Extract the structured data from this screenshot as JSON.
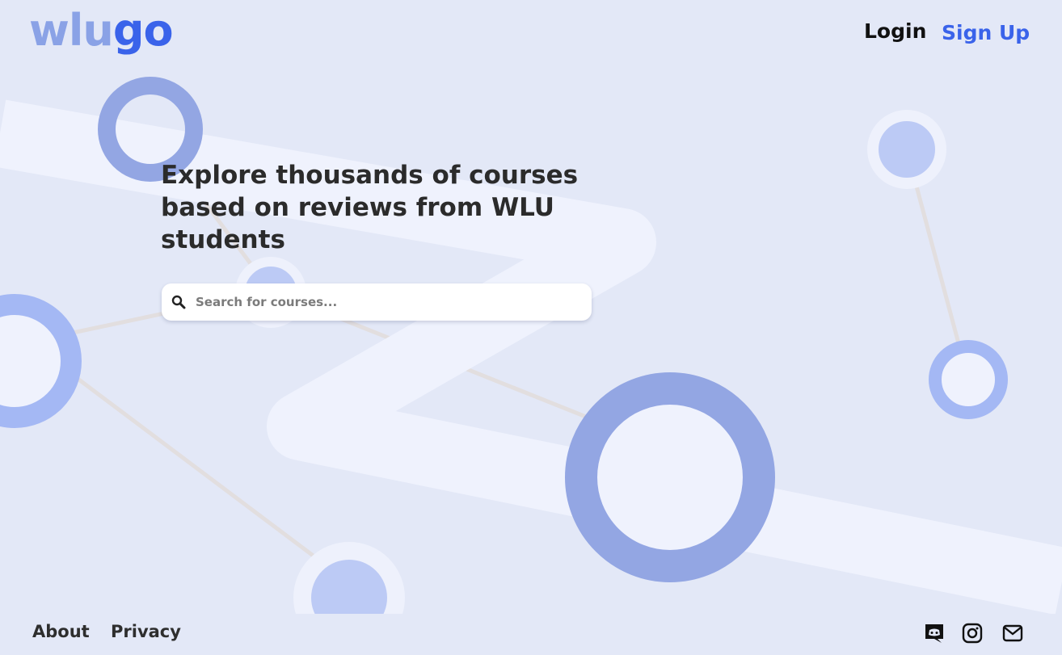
{
  "brand": {
    "logo_part1": "wlu",
    "logo_part2": "go",
    "color_light": "#8aa2e6",
    "color_dark": "#3a63ea"
  },
  "nav": {
    "login_label": "Login",
    "signup_label": "Sign Up"
  },
  "hero": {
    "headline": "Explore thousands of courses based on reviews from WLU students"
  },
  "search": {
    "placeholder": "Search for courses...",
    "value": "",
    "icon": "search-icon"
  },
  "footer": {
    "links": [
      "About",
      "Privacy"
    ],
    "social_icons": [
      "discord-icon",
      "instagram-icon",
      "mail-icon"
    ]
  }
}
